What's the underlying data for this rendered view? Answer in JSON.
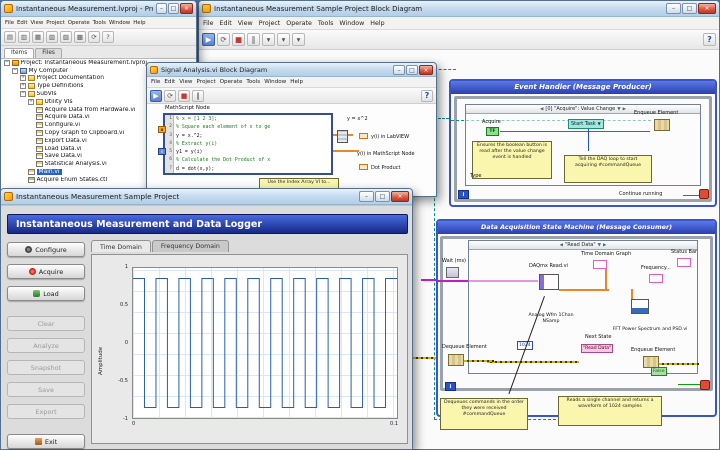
{
  "icons": {
    "min": "–",
    "max": "□",
    "close": "×",
    "help": "?",
    "dropdown": "▼",
    "left_arrow": "◀",
    "right_arrow": "▶"
  },
  "menu": [
    "File",
    "Edit",
    "View",
    "Project",
    "Operate",
    "Tools",
    "Window",
    "Help"
  ],
  "project": {
    "title": "Instantaneous Measurement.lvproj - Project ...",
    "toolbar": [
      {
        "name": "new-vi-button",
        "glyph": "▤"
      },
      {
        "name": "open-button",
        "glyph": "▥"
      },
      {
        "name": "save-button",
        "glyph": "▦"
      },
      {
        "name": "cut-button",
        "glyph": "▧"
      },
      {
        "name": "copy-button",
        "glyph": "▨"
      },
      {
        "name": "paste-button",
        "glyph": "▩"
      },
      {
        "name": "refresh-button",
        "glyph": "⟳"
      },
      {
        "name": "help-button",
        "glyph": "?"
      }
    ],
    "tabs": [
      {
        "name": "tab-items",
        "label": "Items",
        "active": true
      },
      {
        "name": "tab-files",
        "label": "Files"
      }
    ],
    "tree": [
      {
        "name": "tree-item-project",
        "label": "Project: Instantaneous Measurement.lvproj",
        "depth": 0,
        "icon": "lv",
        "exp": "−"
      },
      {
        "name": "tree-item-my-computer",
        "label": "My Computer",
        "depth": 1,
        "icon": "computer",
        "exp": "−"
      },
      {
        "name": "tree-item-project-documentation",
        "label": "Project Documentation",
        "depth": 2,
        "icon": "folder",
        "exp": "+"
      },
      {
        "name": "tree-item-type-definitions",
        "label": "Type Definitions",
        "depth": 2,
        "icon": "folder",
        "exp": "+"
      },
      {
        "name": "tree-item-subvis",
        "label": "SubVIs",
        "depth": 2,
        "icon": "folder",
        "exp": "−"
      },
      {
        "name": "tree-item-utility-vis",
        "label": "Utility VIs",
        "depth": 3,
        "icon": "folder",
        "exp": "+"
      },
      {
        "name": "tree-item-acquire-data-from-hardware",
        "label": "Acquire Data from Hardware.vi",
        "depth": 3,
        "icon": "vi"
      },
      {
        "name": "tree-item-acquire-data",
        "label": "Acquire Data.vi",
        "depth": 3,
        "icon": "vi"
      },
      {
        "name": "tree-item-configure",
        "label": "Configure.vi",
        "depth": 3,
        "icon": "vi"
      },
      {
        "name": "tree-item-copy-graph",
        "label": "Copy Graph to Clipboard.vi",
        "depth": 3,
        "icon": "vi"
      },
      {
        "name": "tree-item-export-data",
        "label": "Export Data.vi",
        "depth": 3,
        "icon": "vi"
      },
      {
        "name": "tree-item-load-data",
        "label": "Load Data.vi",
        "depth": 3,
        "icon": "vi"
      },
      {
        "name": "tree-item-save-data",
        "label": "Save Data.vi",
        "depth": 3,
        "icon": "vi"
      },
      {
        "name": "tree-item-statistical-analysis",
        "label": "Statistical Analysis.vi",
        "depth": 3,
        "icon": "vi"
      },
      {
        "name": "tree-item-main",
        "label": "Main.vi",
        "depth": 2,
        "icon": "vi",
        "selected": true
      },
      {
        "name": "tree-item-acquire-enum-states",
        "label": "Acquire Enum States.ctl",
        "depth": 2,
        "icon": "ctl"
      }
    ]
  },
  "signal": {
    "title": "Signal Analysis.vi Block Diagram",
    "toolbar": [
      {
        "name": "run-button",
        "glyph": "▶",
        "cls": "run"
      },
      {
        "name": "run-continuous-button",
        "glyph": "⟳"
      },
      {
        "name": "abort-button",
        "glyph": "■",
        "cls": "stop"
      },
      {
        "name": "pause-button",
        "glyph": "‖"
      }
    ],
    "node_label": "MathScript Node",
    "code": [
      {
        "n": "1",
        "text": "% x = [1 2 3];",
        "cls": "c-comment"
      },
      {
        "n": "2",
        "text": "% Square each element of x to ge",
        "cls": "c-comment"
      },
      {
        "n": "3",
        "text": "y = x.^2;",
        "cls": "c-code"
      },
      {
        "n": "4",
        "text": "% Extract y(i)",
        "cls": "c-comment"
      },
      {
        "n": "5",
        "text": "y1 = y(i)",
        "cls": "c-code"
      },
      {
        "n": "6",
        "text": "% Calculate the Dot Product of x",
        "cls": "c-comment"
      },
      {
        "n": "7",
        "text": "d = dot(x,y);",
        "cls": "c-code"
      }
    ],
    "term_x": "x",
    "term_i": "i",
    "label_y": "y = x^2",
    "label_ylv": "y(i) in LabVIEW",
    "label_yms": "y(i) in MathScript Node",
    "label_dot": "Dot Product",
    "tooltip": "Use the Index Array VI to..."
  },
  "bd": {
    "title": "Instantaneous Measurement Sample Project Block Diagram",
    "toolbar": [
      {
        "name": "run-button",
        "glyph": "▶",
        "cls": "run"
      },
      {
        "name": "run-continuous-button",
        "glyph": "⟳"
      },
      {
        "name": "abort-button",
        "glyph": "■",
        "cls": "stop"
      },
      {
        "name": "pause-button",
        "glyph": "‖"
      },
      {
        "name": "text-settings-dropdown",
        "glyph": "▾"
      },
      {
        "name": "align-objects-dropdown",
        "glyph": "▾"
      },
      {
        "name": "distribute-objects-dropdown",
        "glyph": "▾"
      }
    ],
    "event": {
      "header": "Event Handler (Message Producer)",
      "case": "[0] \"Acquire\": Value Change",
      "acquire": "Acquire",
      "tf": "TF",
      "start_task": "Start Task",
      "note_read": "Ensures the boolean button is read after the value change event is handled",
      "note_tell": "Tell the DAQ loop to start acquiring #commandQueue",
      "enqueue": "Enqueue Element",
      "continue_running": "Continue running",
      "type": "Type",
      "iter": "i"
    },
    "sm": {
      "header": "Data Acquisition State Machine (Message Consumer)",
      "case": "\"Read Data\"",
      "wait": "Wait (ms)",
      "dequeue": "Dequeue Element",
      "samples": "1024",
      "daqmx": "DAQmx Read.vi",
      "daqmx_mode": "Analog Wfm 1Chan NSamp",
      "time_graph": "Time Domain Graph",
      "freq_graph": "Frequency...",
      "fft": "FFT Power Spectrum and PSD.vi",
      "status": "Status Bar",
      "next_state": "Next State",
      "read_const": "\"Read Data\"",
      "enqueue": "Enqueue Element",
      "false_const": "False",
      "iter": "i",
      "note_dequeue": "Dequeues commands in the order they were received #commandQueue",
      "note_read": "Reads a single channel and returns a waveform of 1024 samples"
    }
  },
  "fp": {
    "title": "Instantaneous Measurement Sample Project",
    "banner": "Instantaneous Measurement and Data Logger",
    "buttons": [
      {
        "name": "configure-button",
        "label": "Configure",
        "state": "enabled",
        "icon": "gear"
      },
      {
        "name": "acquire-button",
        "label": "Acquire",
        "state": "enabled",
        "icon": "record"
      },
      {
        "name": "load-button",
        "label": "Load",
        "state": "enabled",
        "icon": "load"
      },
      {
        "name": "clear-button",
        "label": "Clear",
        "state": "disabled",
        "gap": true
      },
      {
        "name": "analyze-button",
        "label": "Analyze",
        "state": "disabled"
      },
      {
        "name": "snapshot-button",
        "label": "Snapshot",
        "state": "disabled"
      },
      {
        "name": "save-button",
        "label": "Save",
        "state": "disabled"
      },
      {
        "name": "export-button",
        "label": "Export",
        "state": "disabled"
      },
      {
        "name": "exit-button",
        "label": "Exit",
        "state": "enabled",
        "icon": "exit",
        "gap": true
      }
    ],
    "tabs": [
      {
        "name": "tab-time-domain",
        "label": "Time Domain",
        "active": true
      },
      {
        "name": "tab-frequency-domain",
        "label": "Frequency Domain"
      }
    ],
    "chart_data": {
      "type": "line",
      "wave": "square",
      "cycles": 11.5,
      "amplitude": 1,
      "title": "",
      "xlabel": "",
      "ylabel": "Amplitude",
      "yticks": [
        "1",
        "0.5",
        "0",
        "-0.5",
        "-1"
      ],
      "xticks": [
        "0",
        "0.1"
      ],
      "ylim": [
        -1,
        1
      ],
      "grid": true,
      "line_color": "#2a5fa8"
    }
  }
}
